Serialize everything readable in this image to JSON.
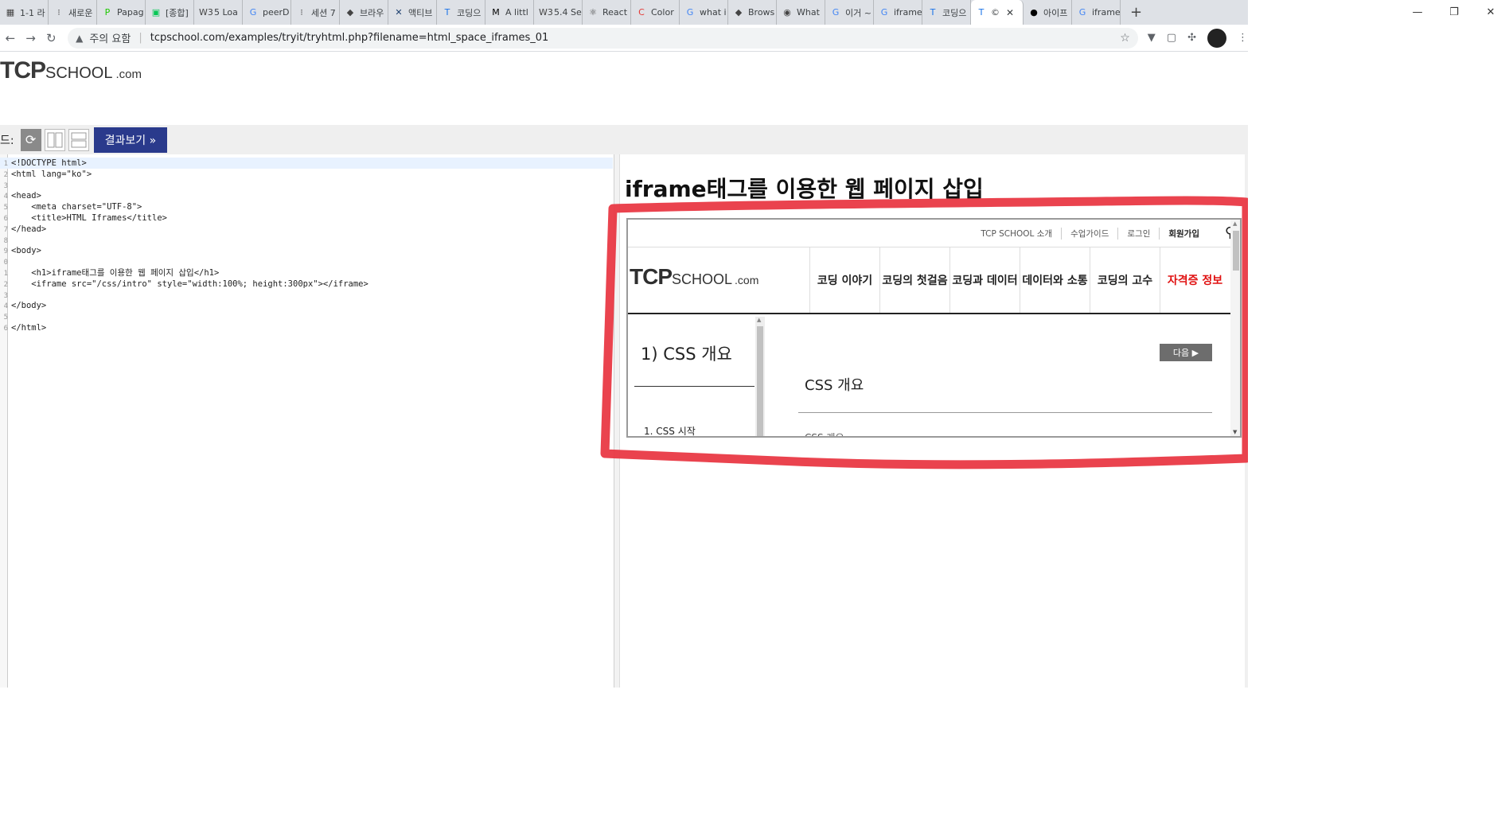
{
  "browser": {
    "tabs": [
      {
        "label": "1-1 라",
        "icon": "doc-icon"
      },
      {
        "label": "새로운",
        "icon": "dots-icon"
      },
      {
        "label": "Papag",
        "icon": "papago-icon"
      },
      {
        "label": "[종합]",
        "icon": "chat-icon"
      },
      {
        "label": "5 Loa",
        "icon": "w3-icon"
      },
      {
        "label": "peerD",
        "icon": "google-icon"
      },
      {
        "label": "세션 7",
        "icon": "dots-icon"
      },
      {
        "label": "브라우",
        "icon": "bird-icon"
      },
      {
        "label": "액티브",
        "icon": "x-icon"
      },
      {
        "label": "코딩으",
        "icon": "t-icon"
      },
      {
        "label": "A littl",
        "icon": "medium-icon"
      },
      {
        "label": "5.4 Se",
        "icon": "w3-icon"
      },
      {
        "label": "React",
        "icon": "react-icon"
      },
      {
        "label": "Color",
        "icon": "c-icon"
      },
      {
        "label": "what i",
        "icon": "google-icon"
      },
      {
        "label": "Brows",
        "icon": "bird-icon"
      },
      {
        "label": "What",
        "icon": "eye-icon"
      },
      {
        "label": "이거 ~",
        "icon": "google-icon"
      },
      {
        "label": "iframe",
        "icon": "google-icon"
      },
      {
        "label": "코딩으",
        "icon": "t-icon"
      },
      {
        "label": "©",
        "icon": "t-icon",
        "active": true
      },
      {
        "label": "아이프",
        "icon": "circle-icon"
      },
      {
        "label": "iframe",
        "icon": "google-icon"
      }
    ],
    "address": {
      "security_label": "주의 요함",
      "url": "tcpschool.com/examples/tryit/tryhtml.php?filename=html_space_iframes_01"
    }
  },
  "site_logo": {
    "bold": "TCP",
    "rest": "SCHOOL",
    "suffix": ".com"
  },
  "controls": {
    "mode_label": "드:",
    "result_button": "결과보기 »"
  },
  "code_lines": [
    {
      "num": "1",
      "text": "<!DOCTYPE html>"
    },
    {
      "num": "2",
      "text": "<html lang=\"ko\">"
    },
    {
      "num": "3",
      "text": ""
    },
    {
      "num": "4",
      "text": "<head>"
    },
    {
      "num": "5",
      "text": "    <meta charset=\"UTF-8\">"
    },
    {
      "num": "6",
      "text": "    <title>HTML Iframes</title>"
    },
    {
      "num": "7",
      "text": "</head>"
    },
    {
      "num": "8",
      "text": ""
    },
    {
      "num": "9",
      "text": "<body>"
    },
    {
      "num": "0",
      "text": ""
    },
    {
      "num": "1",
      "text": "    <h1>iframe태그를 이용한 웹 페이지 삽입</h1>"
    },
    {
      "num": "2",
      "text": "    <iframe src=\"/css/intro\" style=\"width:100%; height:300px\"></iframe>"
    },
    {
      "num": "3",
      "text": ""
    },
    {
      "num": "4",
      "text": "</body>"
    },
    {
      "num": "5",
      "text": ""
    },
    {
      "num": "6",
      "text": "</html>"
    }
  ],
  "result": {
    "heading": "iframe태그를 이용한 웹 페이지 삽입",
    "iframe": {
      "top_links": [
        "TCP SCHOOL 소개",
        "수업가이드",
        "로그인",
        "회원가입"
      ],
      "logo": {
        "bold": "TCP",
        "rest": "SCHOOL",
        "suffix": ".com"
      },
      "main_nav": [
        "코딩 이야기",
        "코딩의 첫걸음",
        "코딩과 데이터",
        "데이터와 소통",
        "코딩의 고수",
        "자격증 정보"
      ],
      "sidebar_title": "1) CSS 개요",
      "sidebar_item": "1. CSS 시작",
      "next_button": "다음 ▶",
      "content_title": "CSS 개요",
      "content_below": "CSS 개요"
    }
  },
  "colors": {
    "accent_button": "#2a3a8c",
    "annotation_red": "#e8333f",
    "nav_highlight": "#e01010"
  }
}
